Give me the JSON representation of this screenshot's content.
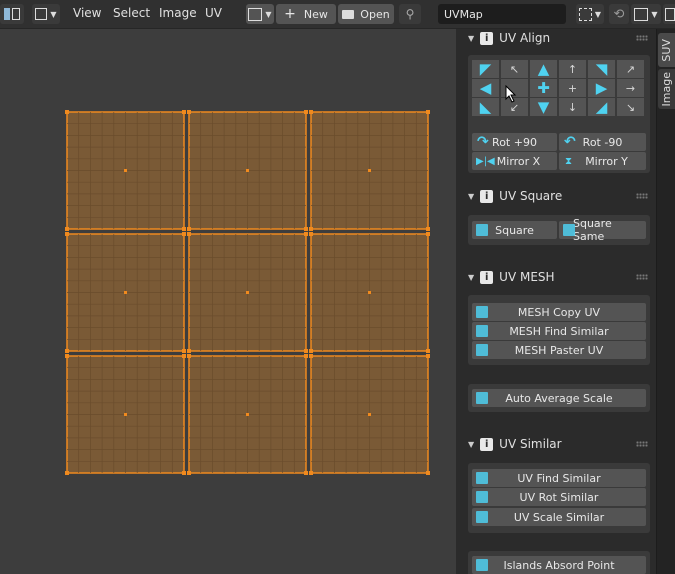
{
  "header": {
    "menus": [
      "View",
      "Select",
      "Image",
      "UV"
    ],
    "new_label": "New",
    "open_label": "Open",
    "uvmap_value": "UVMap"
  },
  "sidebar_tabs": [
    "SUV",
    "Image"
  ],
  "panels": {
    "uv_align": {
      "title": "UV Align",
      "small_arrows": [
        "↖",
        "↑",
        "↗",
        "+",
        "→",
        "↙",
        "↓",
        "↘"
      ],
      "rot_plus": "Rot +90",
      "rot_minus": "Rot -90",
      "mirror_x": "Mirror X",
      "mirror_y": "Mirror Y"
    },
    "uv_square": {
      "title": "UV Square",
      "square": "Square",
      "square_same": "Square Same"
    },
    "uv_mesh": {
      "title": "UV MESH",
      "copy": "MESH Copy UV",
      "find": "MESH Find Similar",
      "paste": "MESH Paster UV",
      "auto_avg": "Auto Average Scale"
    },
    "uv_similar": {
      "title": "UV Similar",
      "find": "UV Find Similar",
      "rot": "UV Rot Similar",
      "scale": "UV Scale Similar",
      "islands": "Islands Absord Point"
    }
  },
  "colors": {
    "accent": "#4fd2f0",
    "uv_fill": "#7a5a36",
    "uv_edge": "#f08a1e"
  }
}
